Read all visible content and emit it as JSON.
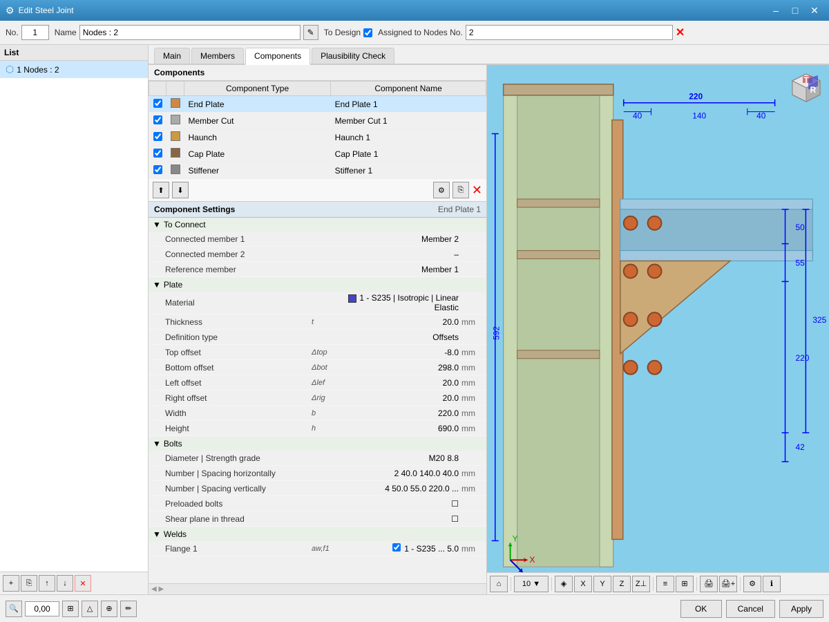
{
  "titlebar": {
    "title": "Edit Steel Joint",
    "icon": "⚙"
  },
  "header": {
    "no_label": "No.",
    "no_value": "1",
    "name_label": "Name",
    "name_value": "Nodes : 2",
    "to_design_label": "To Design",
    "to_design_checked": true,
    "assigned_label": "Assigned to Nodes No.",
    "assigned_value": "2"
  },
  "tabs": [
    {
      "label": "Main",
      "active": false
    },
    {
      "label": "Members",
      "active": false
    },
    {
      "label": "Components",
      "active": true
    },
    {
      "label": "Plausibility Check",
      "active": false
    }
  ],
  "list": {
    "header": "List",
    "items": [
      {
        "label": "1  Nodes : 2",
        "selected": true
      }
    ]
  },
  "components": {
    "section_title": "Components",
    "col_type": "Component Type",
    "col_name": "Component Name",
    "rows": [
      {
        "checked": true,
        "color": "#cc8844",
        "type": "End Plate",
        "name": "End Plate 1",
        "selected": true
      },
      {
        "checked": true,
        "color": "#aaaaaa",
        "type": "Member Cut",
        "name": "Member Cut 1",
        "selected": false
      },
      {
        "checked": true,
        "color": "#cc9944",
        "type": "Haunch",
        "name": "Haunch 1",
        "selected": false
      },
      {
        "checked": true,
        "color": "#886644",
        "type": "Cap Plate",
        "name": "Cap Plate 1",
        "selected": false
      },
      {
        "checked": true,
        "color": "#888888",
        "type": "Stiffener",
        "name": "Stiffener 1",
        "selected": false
      }
    ]
  },
  "settings": {
    "title": "Component Settings",
    "subtitle": "End Plate 1",
    "groups": [
      {
        "label": "To Connect",
        "expanded": true,
        "rows": [
          {
            "name": "Connected member 1",
            "symbol": "",
            "value": "Member 2",
            "unit": ""
          },
          {
            "name": "Connected member 2",
            "symbol": "",
            "value": "–",
            "unit": ""
          },
          {
            "name": "Reference member",
            "symbol": "",
            "value": "Member 1",
            "unit": ""
          }
        ]
      },
      {
        "label": "Plate",
        "expanded": true,
        "rows": [
          {
            "name": "Material",
            "symbol": "",
            "value": "1 - S235 | Isotropic | Linear Elastic",
            "unit": "",
            "mat": true
          },
          {
            "name": "Thickness",
            "symbol": "t",
            "value": "20.0",
            "unit": "mm"
          },
          {
            "name": "Definition type",
            "symbol": "",
            "value": "Offsets",
            "unit": ""
          },
          {
            "name": "Top offset",
            "symbol": "Δtop",
            "value": "-8.0",
            "unit": "mm"
          },
          {
            "name": "Bottom offset",
            "symbol": "Δbot",
            "value": "298.0",
            "unit": "mm"
          },
          {
            "name": "Left offset",
            "symbol": "Δlef",
            "value": "20.0",
            "unit": "mm"
          },
          {
            "name": "Right offset",
            "symbol": "Δrig",
            "value": "20.0",
            "unit": "mm"
          },
          {
            "name": "Width",
            "symbol": "b",
            "value": "220.0",
            "unit": "mm"
          },
          {
            "name": "Height",
            "symbol": "h",
            "value": "690.0",
            "unit": "mm"
          }
        ]
      },
      {
        "label": "Bolts",
        "expanded": true,
        "rows": [
          {
            "name": "Diameter | Strength grade",
            "symbol": "",
            "value": "M20   8.8",
            "unit": ""
          },
          {
            "name": "Number | Spacing horizontally",
            "symbol": "",
            "value": "2   40.0  140.0  40.0",
            "unit": "mm"
          },
          {
            "name": "Number | Spacing vertically",
            "symbol": "",
            "value": "4   50.0  55.0  220.0 ...",
            "unit": "mm"
          },
          {
            "name": "Preloaded bolts",
            "symbol": "",
            "value": "☐",
            "unit": ""
          },
          {
            "name": "Shear plane in thread",
            "symbol": "",
            "value": "☐",
            "unit": ""
          }
        ]
      },
      {
        "label": "Welds",
        "expanded": true,
        "rows": [
          {
            "name": "Flange 1",
            "symbol": "aw,f1",
            "value": "1 - S235 ...   5.0",
            "unit": "mm",
            "weld": true
          }
        ]
      }
    ]
  },
  "view": {
    "dimensions": {
      "top": "220",
      "top_left": "40",
      "top_mid": "140",
      "top_right": "40",
      "d1": "50",
      "d2": "55",
      "d3": "220",
      "d4": "592",
      "d5": "325",
      "d6": "42"
    }
  },
  "bottom_toolbar": {
    "ok_label": "OK",
    "cancel_label": "Cancel",
    "apply_label": "Apply"
  }
}
